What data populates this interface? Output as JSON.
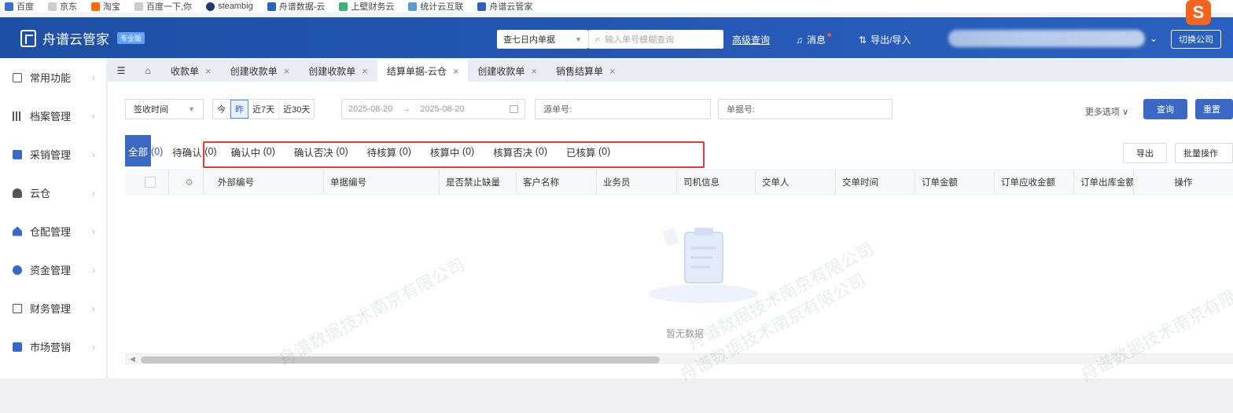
{
  "bookmarks": [
    "百度",
    "京东",
    "淘宝",
    "百度一下,你",
    "steambig",
    "舟谱数据-云",
    "上壁财务云",
    "统计云互联",
    "舟谱云管家"
  ],
  "brand": {
    "name": "舟谱云管家",
    "edition": "专业版"
  },
  "header": {
    "select_value": "查七日内单据",
    "search_placeholder": "输入单号模糊查询",
    "advanced_query": "高级查询",
    "messages": "消息",
    "export_import": "导出/导入",
    "switch_company": "切换公司"
  },
  "sidebar": {
    "items": [
      {
        "label": "常用功能",
        "icon": "star-icon"
      },
      {
        "label": "档案管理",
        "icon": "grid-icon"
      },
      {
        "label": "采销管理",
        "icon": "cart-icon"
      },
      {
        "label": "云仓",
        "icon": "cloud-icon"
      },
      {
        "label": "仓配管理",
        "icon": "warehouse-icon"
      },
      {
        "label": "资金管理",
        "icon": "money-icon"
      },
      {
        "label": "财务管理",
        "icon": "ledger-icon"
      },
      {
        "label": "市场营销",
        "icon": "megaphone-icon"
      }
    ]
  },
  "tabs": [
    {
      "label": "收款单",
      "active": false
    },
    {
      "label": "创建收款单",
      "active": false
    },
    {
      "label": "创建收款单",
      "active": false
    },
    {
      "label": "结算单据-云仓",
      "active": true
    },
    {
      "label": "创建收款单",
      "active": false
    },
    {
      "label": "销售结算单",
      "active": false
    }
  ],
  "filters": {
    "time_field": "签收时间",
    "quick_ranges": [
      "今",
      "昨",
      "近7天",
      "近30天"
    ],
    "date_from": "2025-08-20",
    "date_to": "2025-08-20",
    "source_no_label": "源单号:",
    "doc_no_label": "单据号:",
    "more_options": "更多选项",
    "query": "查询",
    "reset": "重置"
  },
  "status_tabs": {
    "all_label": "全部",
    "all_count": "(0)",
    "items": [
      {
        "label": "待确认",
        "count": "(0)"
      },
      {
        "label": "确认中",
        "count": "(0)"
      },
      {
        "label": "确认否决",
        "count": "(0)"
      },
      {
        "label": "待核算",
        "count": "(0)"
      },
      {
        "label": "核算中",
        "count": "(0)"
      },
      {
        "label": "核算否决",
        "count": "(0)"
      },
      {
        "label": "已核算",
        "count": "(0)"
      }
    ]
  },
  "actions": {
    "export": "导出",
    "batch": "批量操作"
  },
  "table": {
    "columns": [
      "外部编号",
      "单据编号",
      "是否禁止缺量",
      "客户名称",
      "业务员",
      "司机信息",
      "交单人",
      "交单时间",
      "订单金额",
      "订单应收金额",
      "订单出库金额",
      "操作"
    ],
    "empty_text": "暂无数据"
  },
  "watermark": "舟谱数据技术南京有限公司",
  "colors": {
    "header": "#2a60bf",
    "primary": "#3a68c4",
    "highlight": "#e03a3a"
  }
}
